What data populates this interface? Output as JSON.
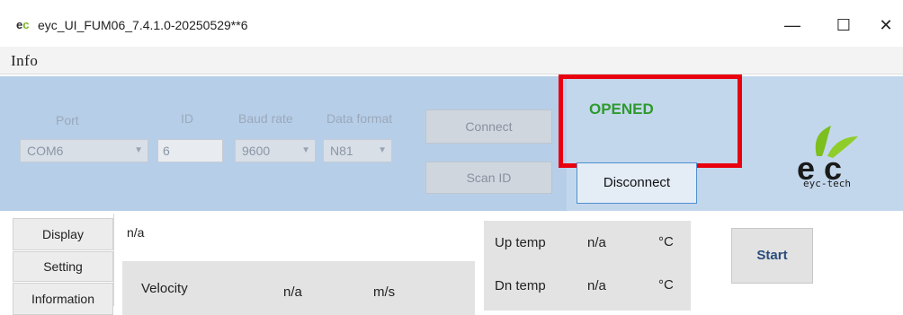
{
  "window": {
    "title": "eyc_UI_FUM06_7.4.1.0-20250529**6",
    "minimize_glyph": "—",
    "maximize_glyph": "☐",
    "close_glyph": "✕"
  },
  "menu": {
    "items": [
      {
        "label": "Info"
      }
    ]
  },
  "connection": {
    "port_label": "Port",
    "port_value": "COM6",
    "id_label": "ID",
    "id_value": "6",
    "baud_label": "Baud rate",
    "baud_value": "9600",
    "format_label": "Data format",
    "format_value": "N81",
    "connect_label": "Connect",
    "scan_label": "Scan ID",
    "status": "OPENED",
    "status_color": "#2e9a2e",
    "disconnect_label": "Disconnect",
    "highlight_color": "#e8000f"
  },
  "logo": {
    "caption": "eyc-tech",
    "icon": "eyc-logo"
  },
  "tabs": [
    {
      "label": "Display"
    },
    {
      "label": "Setting"
    },
    {
      "label": "Information"
    }
  ],
  "display": {
    "status_value": "n/a",
    "velocity_label": "Velocity",
    "velocity_value": "n/a",
    "velocity_unit": "m/s",
    "up_temp_label": "Up temp",
    "up_temp_value": "n/a",
    "up_temp_unit": "°C",
    "dn_temp_label": "Dn temp",
    "dn_temp_value": "n/a",
    "dn_temp_unit": "°C",
    "start_label": "Start"
  }
}
